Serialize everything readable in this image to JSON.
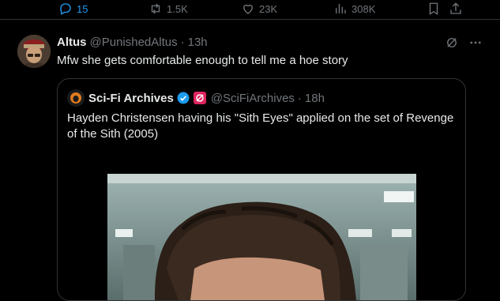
{
  "actions": {
    "replies": "15",
    "reposts": "1.5K",
    "likes": "23K",
    "views": "308K"
  },
  "tweet": {
    "name": "Altus",
    "handle": "@PunishedAltus",
    "separator": "·",
    "time": "13h",
    "text": "Mfw she gets comfortable enough to tell me a hoe story"
  },
  "quote": {
    "name": "Sci-Fi Archives",
    "handle": "@SciFiArchives",
    "separator": "·",
    "time": "18h",
    "text": "Hayden Christensen having his \"Sith Eyes\" applied on the set of Revenge of the Sith (2005)"
  },
  "icons": {
    "reply": "reply-icon",
    "repost": "repost-icon",
    "like": "heart-icon",
    "views": "views-icon",
    "bookmark": "bookmark-icon",
    "share": "share-icon",
    "grok": "grok-icon",
    "more": "more-icon",
    "verified": "verified-icon",
    "affiliate": "affiliate-badge-icon"
  },
  "colors": {
    "background": "#000000",
    "text": "#e7e9ea",
    "muted": "#71767b",
    "accent": "#1d9bf0",
    "border": "#2f3336"
  }
}
